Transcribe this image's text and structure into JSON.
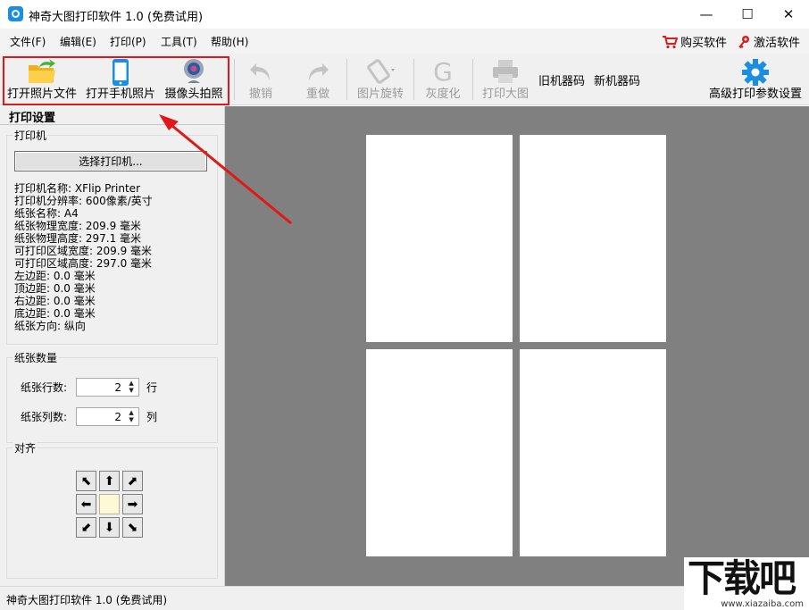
{
  "window": {
    "title": "神奇大图打印软件 1.0 (免费试用)",
    "min_glyph": "—",
    "max_glyph": "☐",
    "close_glyph": "✕"
  },
  "menu": {
    "items": [
      "文件(F)",
      "编辑(E)",
      "打印(P)",
      "工具(T)",
      "帮助(H)"
    ],
    "buy": "购买软件",
    "activate": "激活软件"
  },
  "toolbar": {
    "open_photo": "打开照片文件",
    "open_phone": "打开手机照片",
    "camera": "摄像头拍照",
    "undo": "撤销",
    "redo": "重做",
    "rotate": "图片旋转",
    "gray": "灰度化",
    "print": "打印大图",
    "old_code": "旧机器码",
    "new_code": "新机器码",
    "advanced": "高级打印参数设置"
  },
  "panel": {
    "title": "打印设置",
    "printer_group": "打印机",
    "select_printer": "选择打印机...",
    "printer_info": [
      "打印机名称: XFlip Printer",
      "打印机分辨率: 600像素/英寸",
      "纸张名称: A4",
      "纸张物理宽度: 209.9 毫米",
      "纸张物理高度: 297.1 毫米",
      "可打印区域宽度: 209.9 毫米",
      "可打印区域高度: 297.0 毫米",
      "左边距: 0.0 毫米",
      "顶边距: 0.0 毫米",
      "右边距: 0.0 毫米",
      "底边距: 0.0 毫米",
      "纸张方向: 纵向"
    ],
    "paper_count_group": "纸张数量",
    "rows_label": "纸张行数:",
    "rows_value": "2",
    "rows_unit": "行",
    "cols_label": "纸张列数:",
    "cols_value": "2",
    "cols_unit": "列",
    "align_group": "对齐"
  },
  "preview": {
    "rows": 2,
    "cols": 2
  },
  "status": {
    "text": "神奇大图打印软件 1.0 (免费试用)"
  },
  "watermark": {
    "big": "下载吧",
    "small": "www.xiazaiba.com"
  },
  "colors": {
    "highlight": "#e01818",
    "canvas_bg": "#808080",
    "accent": "#1a8fe0"
  }
}
